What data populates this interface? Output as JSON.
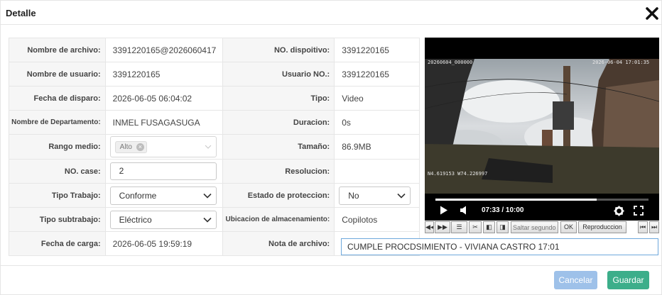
{
  "dialog": {
    "title": "Detalle",
    "close_icon": "close-icon"
  },
  "fields": {
    "nombre_archivo": {
      "label": "Nombre de archivo:",
      "value": "3391220165@20260604170"
    },
    "no_dispositivo": {
      "label": "NO. dispoitivo:",
      "value": "3391220165"
    },
    "nombre_usuario": {
      "label": "Nombre de usuario:",
      "value": "3391220165"
    },
    "usuario_no": {
      "label": "Usuario NO.:",
      "value": "3391220165"
    },
    "fecha_disparo": {
      "label": "Fecha de disparo:",
      "value": "2026-06-05 06:04:02"
    },
    "tipo": {
      "label": "Tipo:",
      "value": "Video"
    },
    "departamento": {
      "label": "Nombre de Departamento:",
      "value": "INMEL FUSAGASUGA"
    },
    "duracion": {
      "label": "Duracion:",
      "value": "0s"
    },
    "rango_medio": {
      "label": "Rango medio:",
      "tag": "Alto"
    },
    "tamano": {
      "label": "Tamaño:",
      "value": "86.9MB"
    },
    "no_case": {
      "label": "NO. case:",
      "value": "2"
    },
    "resolucion": {
      "label": "Resolucion:",
      "value": ""
    },
    "tipo_trabajo": {
      "label": "Tipo Trabajo:",
      "value": "Conforme"
    },
    "estado_proteccion": {
      "label": "Estado de proteccion:",
      "value": "No"
    },
    "tipo_subtrabajo": {
      "label": "Tipo subtrabajo:",
      "value": "Eléctrico"
    },
    "ubicacion": {
      "label": "Ubicacion de almacenamiento:",
      "value": "Copilotos"
    },
    "fecha_carga": {
      "label": "Fecha de carga:",
      "value": "2026-06-05 19:59:19"
    },
    "nota_archivo": {
      "label": "Nota de archivo:",
      "value": "CUMPLE PROCDSIMIENTO - VIVIANA CASTRO 17:01"
    }
  },
  "video": {
    "osd_top_left": "20260604_000000",
    "osd_top_right": "2026-06-04 17:01:35",
    "osd_coords": "N4.619153  W74.226997",
    "time": "07:33 / 10:00",
    "progress": 0.755,
    "icons": [
      "play-icon",
      "volume-icon",
      "gear-icon",
      "fullscreen-icon"
    ]
  },
  "toolbar": {
    "seek_placeholder": "Saltar segundos",
    "ok_label": "OK",
    "reproduccion_label": "Reproduccion"
  },
  "footer": {
    "cancel_label": "Cancelar",
    "save_label": "Guardar"
  },
  "colors": {
    "cancel": "#9ec1e9",
    "save": "#3cae8a",
    "focus_border": "#6ea8dc"
  }
}
